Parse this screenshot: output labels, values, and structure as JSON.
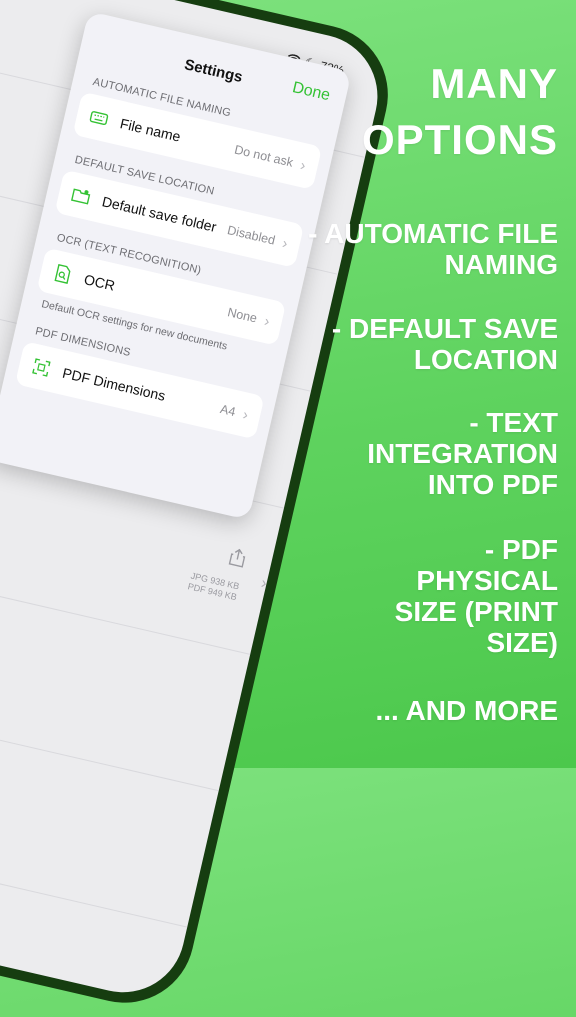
{
  "status_bar": {
    "battery": "72%"
  },
  "settings": {
    "title": "Settings",
    "done": "Done",
    "sections": [
      {
        "header": "AUTOMATIC FILE NAMING",
        "label": "File name",
        "value": "Do not ask",
        "icon": "keyboard-icon"
      },
      {
        "header": "DEFAULT SAVE LOCATION",
        "label": "Default save folder",
        "value": "Disabled",
        "icon": "folder-icon"
      },
      {
        "header": "OCR (TEXT RECOGNITION)",
        "label": "OCR",
        "value": "None",
        "icon": "document-search-icon",
        "footer": "Default OCR settings for new documents"
      },
      {
        "header": "PDF DIMENSIONS",
        "label": "PDF Dimensions",
        "value": "A4",
        "icon": "dimensions-icon"
      }
    ]
  },
  "background_list": {
    "jpg_size": "JPG 938 KB",
    "pdf_size": "PDF 949 KB"
  },
  "promo": {
    "headline": "MANY OPTIONS",
    "features": [
      "- AUTOMATIC FILE NAMING",
      "- DEFAULT SAVE LOCATION",
      "- TEXT INTEGRATION INTO PDF",
      "- PDF PHYSICAL SIZE (PRINT SIZE)",
      "... AND MORE"
    ]
  },
  "colors": {
    "accent": "#35c235",
    "background": "#5fd35f",
    "phone_frame": "#163d10"
  }
}
